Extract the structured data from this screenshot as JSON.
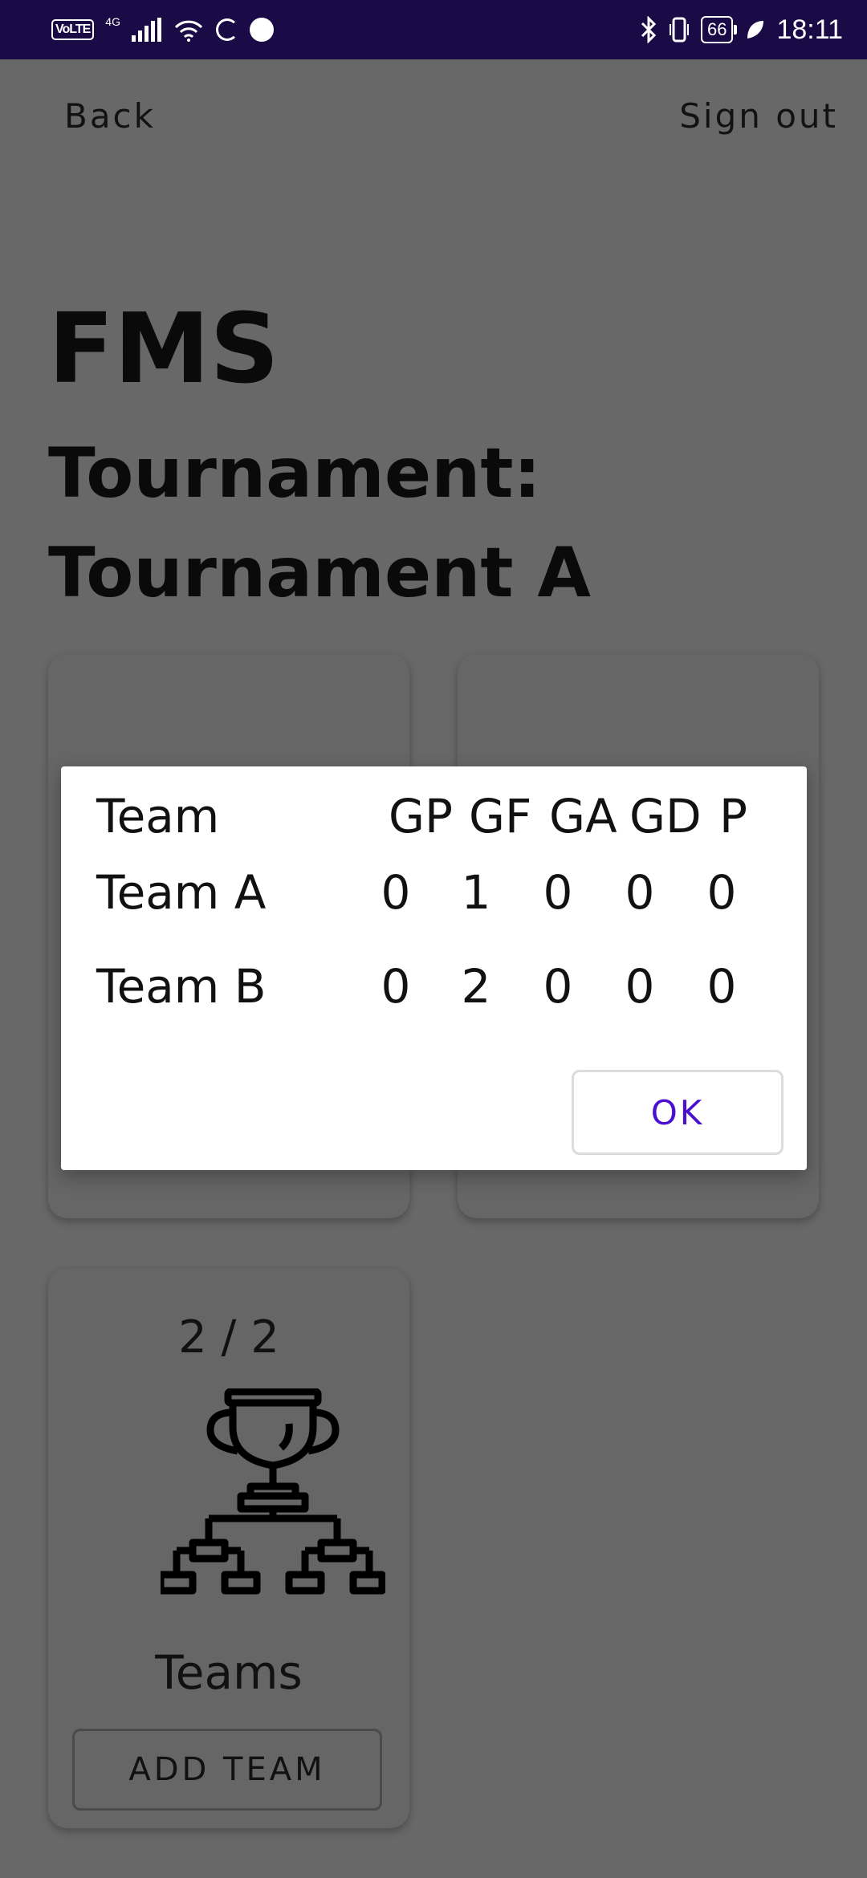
{
  "status_bar": {
    "network_label": "VoLTE",
    "signal_label": "4G",
    "battery": "66",
    "time": "18:11"
  },
  "toolbar": {
    "back_label": "Back",
    "signout_label": "Sign out"
  },
  "header": {
    "app_title": "FMS",
    "subtitle_line1": "Tournament:",
    "subtitle_line2": "Tournament A"
  },
  "teams_card": {
    "count": "2 / 2",
    "label": "Teams",
    "icon": "trophy-bracket-icon",
    "button_label": "ADD TEAM"
  },
  "standings_dialog": {
    "columns": [
      "Team",
      "GP",
      "GF",
      "GA",
      "GD",
      "P"
    ],
    "rows": [
      {
        "team": "Team A",
        "gp": "0",
        "gf": "1",
        "ga": "0",
        "gd": "0",
        "p": "0"
      },
      {
        "team": "Team B",
        "gp": "0",
        "gf": "2",
        "ga": "0",
        "gd": "0",
        "p": "0"
      }
    ],
    "ok_label": "OK"
  },
  "colors": {
    "status_bar": "#1a0a45",
    "scrim_background": "#686868",
    "dialog_background": "#ffffff",
    "accent": "#4a0fd0"
  }
}
